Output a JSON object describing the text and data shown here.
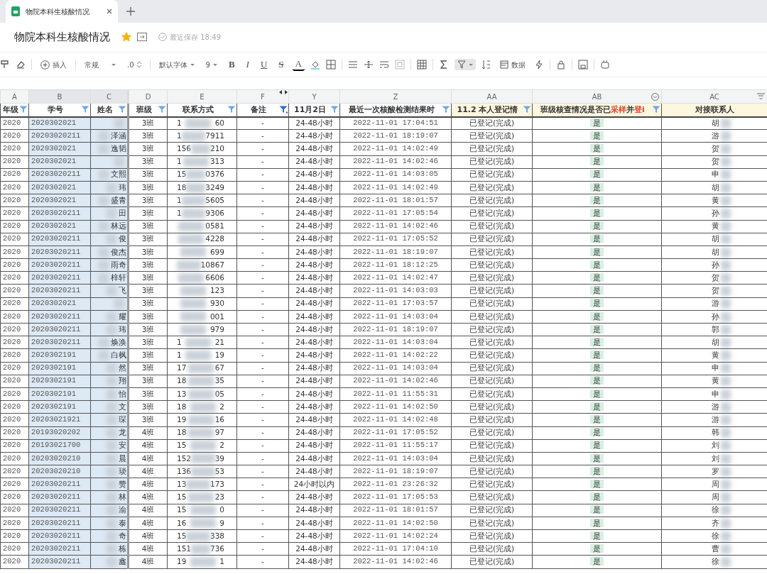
{
  "browser_tab": {
    "title": "物院本科生核酸情况"
  },
  "document": {
    "title": "物院本科生核酸情况",
    "starred": true,
    "save_status": "最近保存 18:49"
  },
  "toolbar": {
    "insert_label": "插入",
    "format_label": "常规",
    "decimal_label": ".0",
    "font_label": "默认字体",
    "size_label": "9",
    "style_letters": [
      "B",
      "I",
      "U",
      "S"
    ],
    "color_letter": "A",
    "data_label": "数据",
    "filter_active": true
  },
  "columns": [
    {
      "letter": "A",
      "header": "年级",
      "filter": true,
      "selected": false,
      "highlight": false
    },
    {
      "letter": "B",
      "header": "学号",
      "filter": true,
      "selected": true,
      "highlight": false
    },
    {
      "letter": "C",
      "header": "姓名",
      "filter": true,
      "selected": true,
      "highlight": false
    },
    {
      "letter": "D",
      "header": "班级",
      "filter": true,
      "selected": false,
      "highlight": false
    },
    {
      "letter": "E",
      "header": "联系方式",
      "filter": true,
      "selected": false,
      "highlight": false
    },
    {
      "letter": "F",
      "header": "备注",
      "filter": true,
      "filter_applied": true,
      "selected": false,
      "highlight": false
    },
    {
      "letter": "Y",
      "header": "11月2日",
      "filter": true,
      "selected": false,
      "highlight": false
    },
    {
      "letter": "Z",
      "header": "最近一次核酸检测结果时",
      "filter": true,
      "selected": false,
      "highlight": false
    },
    {
      "letter": "AA",
      "header": "11.2 本人登记情",
      "filter": true,
      "selected": false,
      "highlight": true
    },
    {
      "letter": "AB",
      "header_parts": [
        {
          "text": "班级核查情况是否已",
          "kind": "plain"
        },
        {
          "text": "采样",
          "kind": "emphasis"
        },
        {
          "text": "并",
          "kind": "plain"
        },
        {
          "text": "登i",
          "kind": "emphasis"
        }
      ],
      "filter": true,
      "selected": false,
      "highlight": true
    },
    {
      "letter": "AC",
      "header": "对接联系人",
      "selected": false,
      "highlight": true
    }
  ],
  "rows": [
    {
      "year": "2020",
      "id": "2020302021",
      "name": "",
      "cls": "3班",
      "phone_a": "1",
      "phone_b": "60",
      "note": "-",
      "y": "24-48小时",
      "z": "2022-11-01 17:04:51",
      "aa": "已登记(完成)",
      "ab": "是",
      "contact": "胡"
    },
    {
      "year": "2020",
      "id": "20203020211",
      "name": "泽涵",
      "cls": "3班",
      "phone_a": "1",
      "phone_b": "7911",
      "note": "-",
      "y": "24-48小时",
      "z": "2022-11-01 18:19:07",
      "aa": "已登记(完成)",
      "ab": "是",
      "contact": "游"
    },
    {
      "year": "2020",
      "id": "2020302021",
      "name": "逸韬",
      "cls": "3班",
      "phone_a": "156",
      "phone_b": "210",
      "note": "-",
      "y": "24-48小时",
      "z": "2022-11-01 14:02:49",
      "aa": "已登记(完成)",
      "ab": "是",
      "contact": "贺"
    },
    {
      "year": "2020",
      "id": "2020302021",
      "name": "",
      "cls": "3班",
      "phone_a": "1",
      "phone_b": "313",
      "note": "-",
      "y": "24-48小时",
      "z": "2022-11-01 14:02:46",
      "aa": "已登记(完成)",
      "ab": "是",
      "contact": "贺"
    },
    {
      "year": "2020",
      "id": "20203020211",
      "name": "文熙",
      "cls": "3班",
      "phone_a": "15",
      "phone_b": "0376",
      "note": "-",
      "y": "24-48小时",
      "z": "2022-11-01 14:03:05",
      "aa": "已登记(完成)",
      "ab": "是",
      "contact": "申"
    },
    {
      "year": "2020",
      "id": "2020302021",
      "name": "玮",
      "cls": "3班",
      "phone_a": "18",
      "phone_b": "3249",
      "note": "-",
      "y": "24-48小时",
      "z": "2022-11-01 14:02:49",
      "aa": "已登记(完成)",
      "ab": "是",
      "contact": "胡"
    },
    {
      "year": "2020",
      "id": "2020302021",
      "name": "盛青",
      "cls": "3班",
      "phone_a": "1",
      "phone_b": "5605",
      "note": "-",
      "y": "24-48小时",
      "z": "2022-11-01 18:01:57",
      "aa": "已登记(完成)",
      "ab": "是",
      "contact": "黄"
    },
    {
      "year": "2020",
      "id": "20203020211",
      "name": "田",
      "cls": "3班",
      "phone_a": "1",
      "phone_b": "9306",
      "note": "-",
      "y": "24-48小时",
      "z": "2022-11-01 17:05:54",
      "aa": "已登记(完成)",
      "ab": "是",
      "contact": "孙"
    },
    {
      "year": "2020",
      "id": "2020302021",
      "name": "林远",
      "cls": "3班",
      "phone_b": "0581",
      "note": "-",
      "y": "24-48小时",
      "z": "2022-11-01 14:02:46",
      "aa": "已登记(完成)",
      "ab": "是",
      "contact": "黄"
    },
    {
      "year": "2020",
      "id": "20203020211",
      "name": "俊",
      "cls": "3班",
      "phone_b": "4228",
      "note": "-",
      "y": "24-48小时",
      "z": "2022-11-01 17:05:52",
      "aa": "已登记(完成)",
      "ab": "是",
      "contact": "胡"
    },
    {
      "year": "2020",
      "id": "20203020211",
      "name": "俊杰",
      "cls": "3班",
      "phone_b": "699",
      "note": "-",
      "y": "24-48小时",
      "z": "2022-11-01 18:19:07",
      "aa": "已登记(完成)",
      "ab": "是",
      "contact": "胡"
    },
    {
      "year": "2020",
      "id": "20203020211",
      "name": "雨奇",
      "cls": "3班",
      "phone_b": "10867",
      "note": "-",
      "y": "24-48小时",
      "z": "2022-11-01 18:12:25",
      "aa": "已登记(完成)",
      "ab": "是",
      "contact": "孙"
    },
    {
      "year": "2020",
      "id": "20203020211",
      "name": "梓轩",
      "cls": "3班",
      "phone_b": "6606",
      "note": "-",
      "y": "24-48小时",
      "z": "2022-11-01 14:02:47",
      "aa": "已登记(完成)",
      "ab": "是",
      "contact": "贺"
    },
    {
      "year": "2020",
      "id": "20203020211",
      "name": "飞",
      "cls": "3班",
      "phone_b": "123",
      "note": "-",
      "y": "24-48小时",
      "z": "2022-11-01 14:03:03",
      "aa": "已登记(完成)",
      "ab": "是",
      "contact": "贺"
    },
    {
      "year": "2020",
      "id": "2020302021",
      "name": "",
      "cls": "3班",
      "phone_b": "930",
      "note": "-",
      "y": "24-48小时",
      "z": "2022-11-01 17:03:57",
      "aa": "已登记(完成)",
      "ab": "是",
      "contact": "游"
    },
    {
      "year": "2020",
      "id": "20203020211",
      "name": "耀",
      "cls": "3班",
      "phone_b": "001",
      "note": "-",
      "y": "24-48小时",
      "z": "2022-11-01 14:03:04",
      "aa": "已登记(完成)",
      "ab": "是",
      "contact": "孙"
    },
    {
      "year": "2020",
      "id": "20203020211",
      "name": "玮",
      "cls": "3班",
      "phone_b": "979",
      "note": "-",
      "y": "24-48小时",
      "z": "2022-11-01 18:19:07",
      "aa": "已登记(完成)",
      "ab": "是",
      "contact": "郭"
    },
    {
      "year": "2020",
      "id": "20203020211",
      "name": "焕涣",
      "cls": "3班",
      "phone_a": "1",
      "phone_b": "21",
      "note": "-",
      "y": "24-48小时",
      "z": "2022-11-01 14:03:04",
      "aa": "已登记(完成)",
      "ab": "是",
      "contact": "胡"
    },
    {
      "year": "2020",
      "id": "2020302191",
      "name": "白枫",
      "cls": "3班",
      "phone_a": "1",
      "phone_b": "19",
      "note": "-",
      "y": "24-48小时",
      "z": "2022-11-01 14:02:22",
      "aa": "已登记(完成)",
      "ab": "是",
      "contact": "黄"
    },
    {
      "year": "2020",
      "id": "2020302191",
      "name": "然",
      "cls": "3班",
      "phone_a": "17",
      "phone_b": "67",
      "note": "-",
      "y": "24-48小时",
      "z": "2022-11-01 14:03:04",
      "aa": "已登记(完成)",
      "ab": "是",
      "contact": "申"
    },
    {
      "year": "2020",
      "id": "2020302191",
      "name": "翔",
      "cls": "3班",
      "phone_a": "18",
      "phone_b": "35",
      "note": "-",
      "y": "24-48小时",
      "z": "2022-11-01 14:02:46",
      "aa": "已登记(完成)",
      "ab": "是",
      "contact": "黄"
    },
    {
      "year": "2020",
      "id": "2020302191",
      "name": "怡",
      "cls": "3班",
      "phone_a": "13",
      "phone_b": "05",
      "note": "-",
      "y": "24-48小时",
      "z": "2022-11-01 11:55:31",
      "aa": "已登记(完成)",
      "ab": "是",
      "contact": "申"
    },
    {
      "year": "2020",
      "id": "2020302191",
      "name": "文",
      "cls": "3班",
      "phone_a": "18",
      "phone_b": "2",
      "note": "-",
      "y": "24-48小时",
      "z": "2022-11-01 14:02:50",
      "aa": "已登记(完成)",
      "ab": "是",
      "contact": "游"
    },
    {
      "year": "2020",
      "id": "20203021921",
      "name": "琛",
      "cls": "3班",
      "phone_a": "19",
      "phone_b": "16",
      "note": "-",
      "y": "24-48小时",
      "z": "2022-11-01 14:02:48",
      "aa": "已登记(完成)",
      "ab": "是",
      "contact": "游"
    },
    {
      "year": "2020",
      "id": "20193020202",
      "name": "龙",
      "cls": "4班",
      "phone_a": "18",
      "phone_b": "97",
      "note": "-",
      "y": "24-48小时",
      "z": "2022-11-01 17:05:52",
      "aa": "已登记(完成)",
      "ab": "是",
      "contact": "韩"
    },
    {
      "year": "2020",
      "id": "20193021700",
      "name": "安",
      "cls": "4班",
      "phone_a": "15",
      "phone_b": "2",
      "note": "-",
      "y": "24-48小时",
      "z": "2022-11-01 11:55:17",
      "aa": "已登记(完成)",
      "ab": "是",
      "contact": "刘"
    },
    {
      "year": "2020",
      "id": "20203020210",
      "name": "晨",
      "cls": "4班",
      "phone_a": "152",
      "phone_b": "39",
      "note": "-",
      "y": "24-48小时",
      "z": "2022-11-01 14:03:04",
      "aa": "已登记(完成)",
      "ab": "是",
      "contact": "刘"
    },
    {
      "year": "2020",
      "id": "20203020210",
      "name": "琰",
      "cls": "4班",
      "phone_a": "136",
      "phone_b": "53",
      "note": "-",
      "y": "24-48小时",
      "z": "2022-11-01 18:19:07",
      "aa": "已登记(完成)",
      "ab": "是",
      "contact": "罗"
    },
    {
      "year": "2020",
      "id": "20203020211",
      "name": "赞",
      "cls": "4班",
      "phone_a": "13",
      "phone_b": "173",
      "note": "-",
      "y": "24小时以内",
      "z": "2022-11-01 23:26:32",
      "aa": "已登记(完成)",
      "ab": "是",
      "contact": "周"
    },
    {
      "year": "2020",
      "id": "20203020211",
      "name": "林",
      "cls": "4班",
      "phone_a": "15",
      "phone_b": "23",
      "note": "-",
      "y": "24-48小时",
      "z": "2022-11-01 17:05:53",
      "aa": "已登记(完成)",
      "ab": "是",
      "contact": "周"
    },
    {
      "year": "2020",
      "id": "20203020211",
      "name": "渝",
      "cls": "4班",
      "phone_a": "15",
      "phone_b": "0",
      "note": "-",
      "y": "24-48小时",
      "z": "2022-11-01 18:01:57",
      "aa": "已登记(完成)",
      "ab": "是",
      "contact": "徐"
    },
    {
      "year": "2020",
      "id": "20203020211",
      "name": "泰",
      "cls": "4班",
      "phone_a": "16",
      "phone_b": "9",
      "note": "-",
      "y": "24-48小时",
      "z": "2022-11-01 14:02:50",
      "aa": "已登记(完成)",
      "ab": "是",
      "contact": "齐"
    },
    {
      "year": "2020",
      "id": "20203020211",
      "name": "奇",
      "cls": "4班",
      "phone_a": "15",
      "phone_b": "338",
      "note": "-",
      "y": "24-48小时",
      "z": "2022-11-01 14:02:24",
      "aa": "已登记(完成)",
      "ab": "是",
      "contact": "徐"
    },
    {
      "year": "2020",
      "id": "20203020211",
      "name": "栋",
      "cls": "4班",
      "phone_a": "151",
      "phone_b": "736",
      "note": "-",
      "y": "24-48小时",
      "z": "2022-11-01 17:04:10",
      "aa": "已登记(完成)",
      "ab": "是",
      "contact": "曹"
    },
    {
      "year": "2020",
      "id": "20203020211",
      "name": "鑫",
      "cls": "4班",
      "phone_a": "19",
      "phone_b": "1",
      "note": "-",
      "y": "24-48小时",
      "z": "2022-11-01 14:02:46",
      "aa": "已登记(完成)",
      "ab": "是",
      "contact": "徐"
    }
  ]
}
